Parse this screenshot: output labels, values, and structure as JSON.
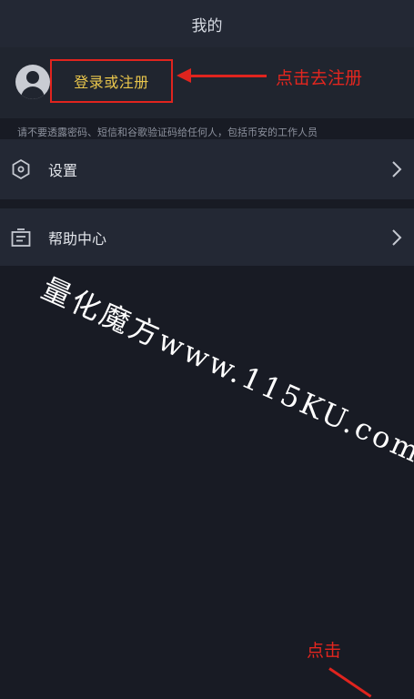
{
  "header": {
    "title": "我的"
  },
  "profile": {
    "login_label": "登录或注册",
    "annotation": "点击去注册"
  },
  "warning_text": "请不要透露密码、短信和谷歌验证码给任何人，包括币安的工作人员",
  "menu": {
    "settings_label": "设置",
    "help_label": "帮助中心"
  },
  "watermark_text": "量化魔方www.115KU.com",
  "annotation_click": "点击",
  "colors": {
    "background": "#181b24",
    "panel": "#232834",
    "accent_yellow": "#e9c64c",
    "annotation_red": "#e0241e"
  }
}
